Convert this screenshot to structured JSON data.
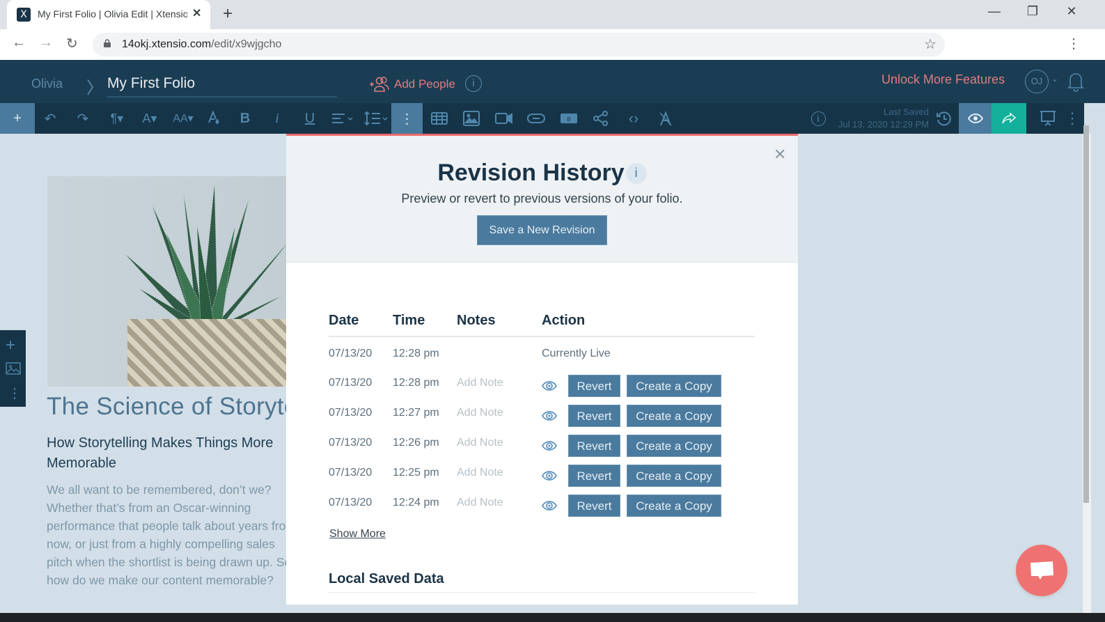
{
  "browser": {
    "tab_title": "My First Folio | Olivia Edit | Xtensio",
    "tab_favicon": "X",
    "url_host": "14okj.xtensio.com",
    "url_path": "/edit/x9wjgcho",
    "icons": {
      "back": "←",
      "forward": "→",
      "reload": "↻",
      "star": "☆",
      "menu": "⋮",
      "close_tab": "✕",
      "new_tab": "+",
      "minimize": "—",
      "restore": "❐",
      "close_window": "✕"
    }
  },
  "app_header": {
    "breadcrumb_user": "Olivia",
    "breadcrumb_sep": "〉",
    "folio_title": "My First Folio",
    "add_people_label": "Add People",
    "info_glyph": "i",
    "unlock_label": "Unlock More Features",
    "avatar_initials": "OJ",
    "avatar_chevron": "⌄"
  },
  "toolbar": {
    "add": "+",
    "undo": "↶",
    "redo": "↷",
    "paragraph": "¶▾",
    "font": "A▾",
    "font_size": "AA▾",
    "bold": "B",
    "italic": "i",
    "underline": "U",
    "more": "⋮",
    "code": "‹›",
    "last_saved_label": "Last Saved",
    "last_saved_time": "Jul 13, 2020 12:29 PM",
    "info_glyph": "i",
    "overflow": "⋮"
  },
  "article": {
    "title": "The Science of Storytelling",
    "subtitle": "How Storytelling Makes Things More Memorable",
    "body": "We all want to be remembered, don’t we? Whether that’s from an Oscar-winning performance that people talk about years from now, or just from a highly compelling sales pitch when the shortlist is being drawn up. So how do we make our content memorable?"
  },
  "side_dock": {
    "add": "+",
    "more": "⋮"
  },
  "modal": {
    "close": "✕",
    "title": "Revision History",
    "title_info": "i",
    "description": "Preview or revert to previous versions of your folio.",
    "save_button": "Save a New Revision",
    "columns": {
      "date": "Date",
      "time": "Time",
      "notes": "Notes",
      "action": "Action"
    },
    "current": {
      "date": "07/13/20",
      "time": "12:28 pm",
      "status": "Currently Live"
    },
    "revisions": [
      {
        "date": "07/13/20",
        "time": "12:28 pm",
        "note": "Add Note",
        "revert": "Revert",
        "copy": "Create a Copy"
      },
      {
        "date": "07/13/20",
        "time": "12:27 pm",
        "note": "Add Note",
        "revert": "Revert",
        "copy": "Create a Copy"
      },
      {
        "date": "07/13/20",
        "time": "12:26 pm",
        "note": "Add Note",
        "revert": "Revert",
        "copy": "Create a Copy"
      },
      {
        "date": "07/13/20",
        "time": "12:25 pm",
        "note": "Add Note",
        "revert": "Revert",
        "copy": "Create a Copy"
      },
      {
        "date": "07/13/20",
        "time": "12:24 pm",
        "note": "Add Note",
        "revert": "Revert",
        "copy": "Create a Copy"
      }
    ],
    "show_more": "Show More",
    "local_saved_title": "Local Saved Data"
  },
  "colors": {
    "header_bg": "#1b3d54",
    "toolbar_bg": "#163447",
    "accent_blue": "#4a7a9e",
    "accent_red": "#ef6b6b",
    "share_teal": "#15b09c"
  }
}
